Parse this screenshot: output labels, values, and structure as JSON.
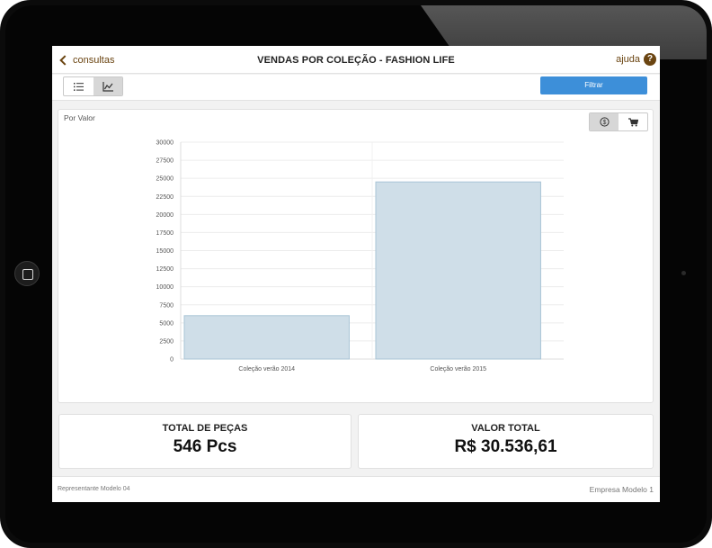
{
  "header": {
    "back_label": "consultas",
    "title": "VENDAS POR COLEÇÃO - FASHION LIFE",
    "help_label": "ajuda",
    "help_icon": "?"
  },
  "toolbar": {
    "view_modes": [
      "list-icon",
      "line-chart-icon"
    ],
    "active_view": "line-chart-icon",
    "filter_label": "Filtrar",
    "filter_color": "#3d8fd9"
  },
  "chart_panel": {
    "title": "Por Valor",
    "metric_modes": [
      "dollar-icon",
      "cart-icon"
    ],
    "active_metric": "dollar-icon"
  },
  "chart_data": {
    "type": "bar",
    "categories": [
      "Coleção verão 2014",
      "Coleção verão 2015"
    ],
    "values": [
      6000,
      24500
    ],
    "ylim": [
      0,
      30000
    ],
    "yticks": [
      0,
      2500,
      5000,
      7500,
      10000,
      12500,
      15000,
      17500,
      20000,
      22500,
      25000,
      27500,
      30000
    ],
    "bar_color": "#cfdee8",
    "bar_border": "#a9c4d6",
    "grid": true
  },
  "summary": {
    "pieces_label": "TOTAL DE PEÇAS",
    "pieces_value": "546 Pcs",
    "total_label": "VALOR TOTAL",
    "total_value": "R$ 30.536,61"
  },
  "footer": {
    "left": "Representante Modelo 04",
    "right": "Empresa Modelo 1"
  }
}
